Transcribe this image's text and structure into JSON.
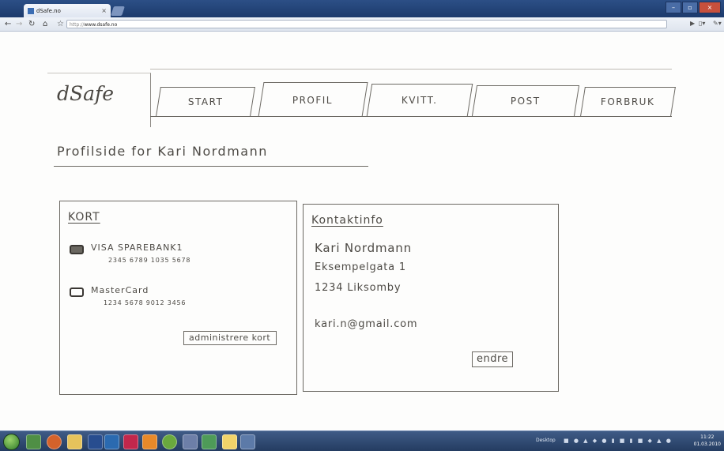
{
  "browser": {
    "tab_title": "dSafe.no",
    "tab_close": "×",
    "url_prefix": "http://",
    "url_host": "www.dsafe.no"
  },
  "site": {
    "logo": "dSafe",
    "tabs": [
      "START",
      "PROFIL",
      "KVITT.",
      "POST",
      "FORBRUK"
    ]
  },
  "profile": {
    "title": "Profilside for Kari Nordmann"
  },
  "cards": {
    "title": "KORT",
    "items": [
      {
        "name": "VISA SPAREBANK1",
        "number": "2345 6789 1035 5678",
        "selected": true
      },
      {
        "name": "MasterCard",
        "number": "1234 5678 9012 3456",
        "selected": false
      }
    ],
    "manage_button": "administrere kort"
  },
  "contact": {
    "title": "Kontaktinfo",
    "name": "Kari Nordmann",
    "street": "Eksempelgata 1",
    "postal": "1234 Liksomby",
    "email": "kari.n@gmail.com",
    "edit_button": "endre"
  },
  "taskbar": {
    "desktop_label": "Desktop",
    "time": "11:22",
    "date": "01.03.2010"
  }
}
